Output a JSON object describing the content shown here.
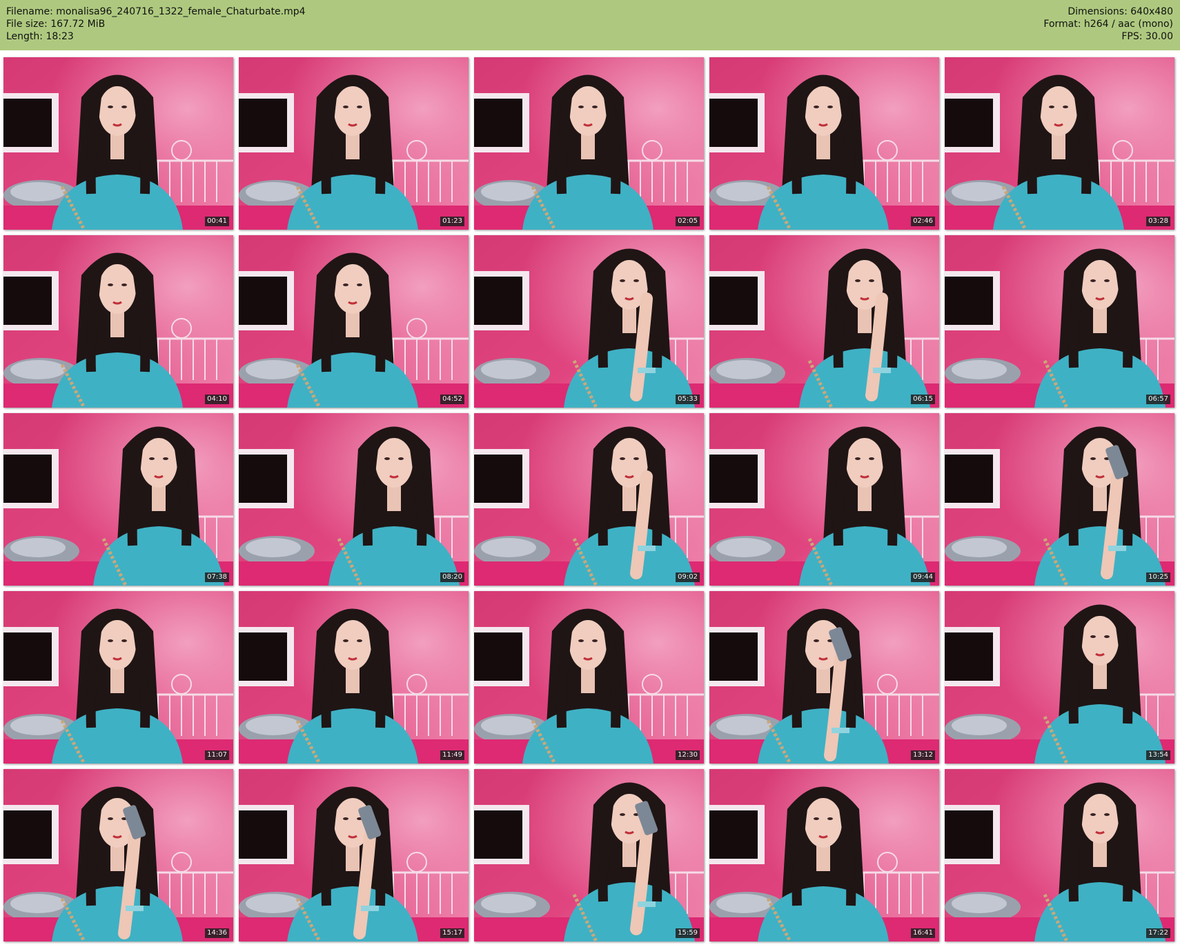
{
  "header": {
    "filename": "Filename: monalisa96_240716_1322_female_Chaturbate.mp4",
    "file_size": "File size: 167.72 MiB",
    "length": "Length: 18:23",
    "dimensions": "Dimensions: 640x480",
    "format": "Format: h264 / aac (mono)",
    "fps": "FPS: 30.00"
  },
  "colors": {
    "header_bg": "#aec97f",
    "wall_pink": "#e0457f",
    "sweater_blue": "#3fb1c4",
    "hair": "#1f1515"
  },
  "thumbs": [
    {
      "ts": "00:41",
      "pose": "center",
      "phone": false
    },
    {
      "ts": "01:23",
      "pose": "center",
      "phone": false
    },
    {
      "ts": "02:05",
      "pose": "center",
      "phone": false
    },
    {
      "ts": "02:46",
      "pose": "center",
      "phone": false
    },
    {
      "ts": "03:28",
      "pose": "center",
      "phone": false
    },
    {
      "ts": "04:10",
      "pose": "center",
      "phone": false
    },
    {
      "ts": "04:52",
      "pose": "center",
      "phone": false
    },
    {
      "ts": "05:33",
      "pose": "right-hand",
      "phone": false
    },
    {
      "ts": "06:15",
      "pose": "right-hand",
      "phone": false
    },
    {
      "ts": "06:57",
      "pose": "right",
      "phone": false
    },
    {
      "ts": "07:38",
      "pose": "right",
      "phone": false
    },
    {
      "ts": "08:20",
      "pose": "right",
      "phone": false
    },
    {
      "ts": "09:02",
      "pose": "right-hand",
      "phone": false
    },
    {
      "ts": "09:44",
      "pose": "right",
      "phone": false
    },
    {
      "ts": "10:25",
      "pose": "right",
      "phone": true
    },
    {
      "ts": "11:07",
      "pose": "center",
      "phone": false
    },
    {
      "ts": "11:49",
      "pose": "center",
      "phone": false
    },
    {
      "ts": "12:30",
      "pose": "center",
      "phone": false
    },
    {
      "ts": "13:12",
      "pose": "center",
      "phone": true
    },
    {
      "ts": "13:54",
      "pose": "right",
      "phone": false
    },
    {
      "ts": "14:36",
      "pose": "center",
      "phone": true
    },
    {
      "ts": "15:17",
      "pose": "center",
      "phone": true
    },
    {
      "ts": "15:59",
      "pose": "right-hand",
      "phone": true
    },
    {
      "ts": "16:41",
      "pose": "center",
      "phone": false
    },
    {
      "ts": "17:22",
      "pose": "right",
      "phone": false
    }
  ]
}
